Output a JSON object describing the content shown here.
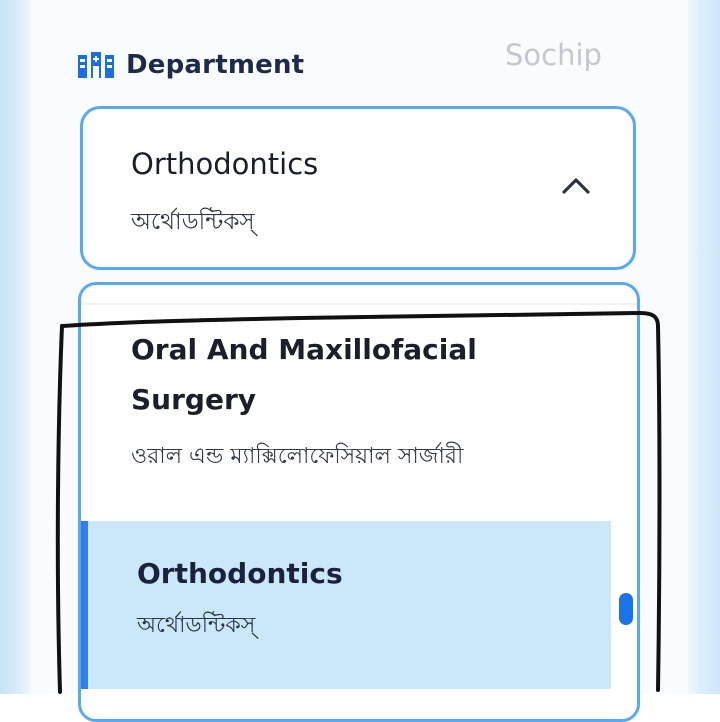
{
  "header": {
    "department_label": "Department",
    "watermark": "Sochip"
  },
  "select": {
    "selected_title": "Orthodontics",
    "selected_subtitle": "অর্থোডন্টিকস্"
  },
  "dropdown": {
    "options": [
      {
        "title": "Oral And Maxillofacial Surgery",
        "subtitle": "ওরাল এন্ড ম্যাক্সিলোফেসিয়াল সার্জারী",
        "selected": false
      },
      {
        "title": "Orthodontics",
        "subtitle": "অর্থোডন্টিকস্",
        "selected": true
      }
    ]
  },
  "colors": {
    "border_blue": "#5aa8f2",
    "selected_bg": "#cbe8fb",
    "accent": "#2f80ed",
    "scrollbar": "#1a73e8",
    "annotation_ink": "#111111"
  },
  "icons": {
    "department": "hospital-building-icon",
    "chevron": "chevron-up-icon"
  }
}
